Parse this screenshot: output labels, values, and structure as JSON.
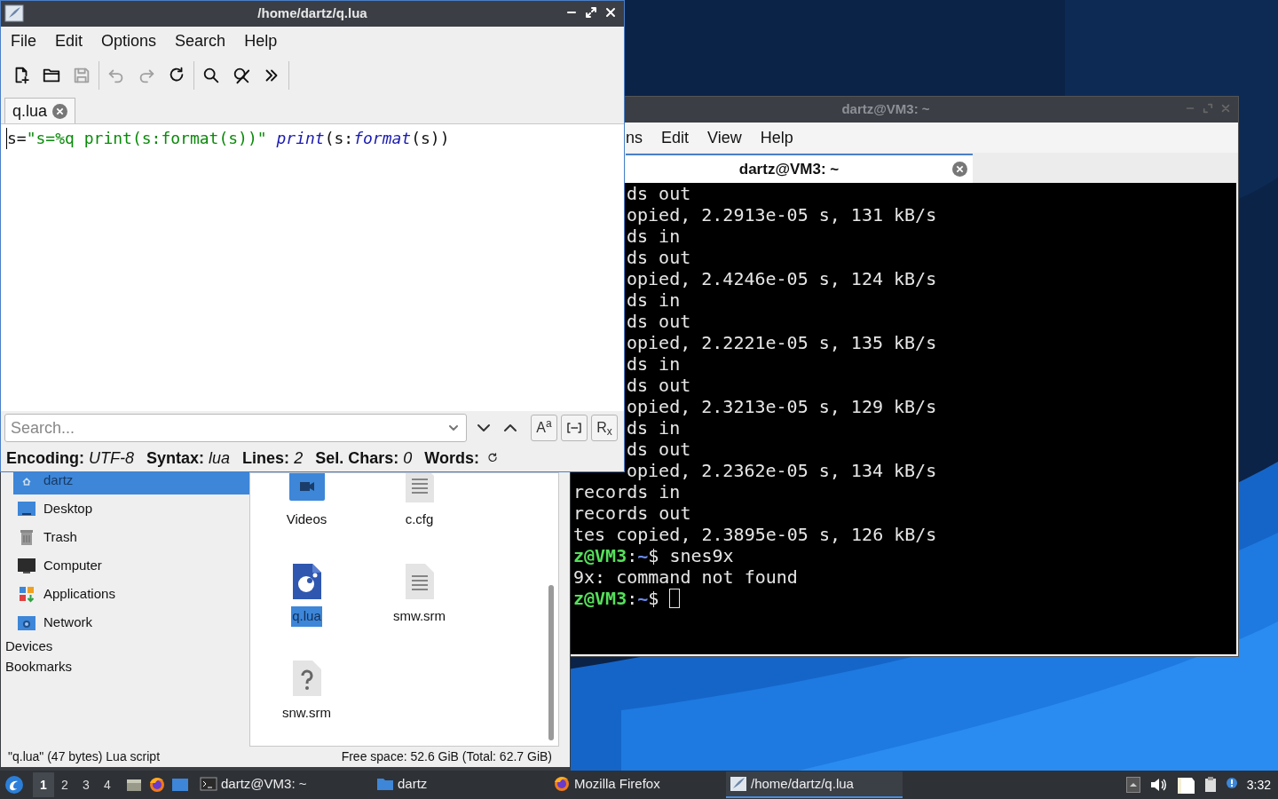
{
  "editor": {
    "title": "/home/dartz/q.lua",
    "menu": [
      "File",
      "Edit",
      "Options",
      "Search",
      "Help"
    ],
    "toolbar": [
      [
        {
          "kind": "new",
          "disabled": false
        },
        {
          "kind": "open",
          "disabled": false
        },
        {
          "kind": "save",
          "disabled": true
        }
      ],
      [
        {
          "kind": "undo",
          "disabled": true
        },
        {
          "kind": "redo",
          "disabled": true
        },
        {
          "kind": "reload",
          "disabled": false
        }
      ],
      [
        {
          "kind": "find",
          "disabled": false
        },
        {
          "kind": "replace",
          "disabled": false
        },
        {
          "kind": "more",
          "disabled": false
        }
      ]
    ],
    "tabs": [
      {
        "label": "q.lua",
        "selected": true
      }
    ],
    "code": [
      {
        "kind": "plain",
        "text": "s="
      },
      {
        "kind": "string",
        "text": "\"s=%q print(s:format(s))\" "
      },
      {
        "kind": "builtin",
        "text": "print"
      },
      {
        "kind": "plain",
        "text": "(s:"
      },
      {
        "kind": "builtin",
        "text": "format"
      },
      {
        "kind": "plain",
        "text": "(s))"
      }
    ],
    "search": {
      "placeholder": "Search..."
    },
    "toggles": [
      {
        "kind": "text",
        "label": "A$^{a}$"
      },
      {
        "kind": "word"
      },
      {
        "kind": "text",
        "label": "R$_{x}$"
      }
    ],
    "status": [
      {
        "label": "Encoding:",
        "value": "UTF-8"
      },
      {
        "label": "Syntax:",
        "value": "lua"
      },
      {
        "label": "Lines:",
        "value": "2"
      },
      {
        "label": "Sel. Chars:",
        "value": "0"
      },
      {
        "label": "Words:"
      }
    ]
  },
  "file_manager": {
    "places": [
      {
        "label": "dartz",
        "kind": "home",
        "selected": true
      },
      {
        "label": "Desktop",
        "kind": "desktop",
        "selected": false
      },
      {
        "label": "Trash",
        "kind": "trash",
        "selected": false
      },
      {
        "label": "Computer",
        "kind": "computer",
        "selected": false
      },
      {
        "label": "Applications",
        "kind": "apps",
        "selected": false
      },
      {
        "label": "Network",
        "kind": "network",
        "selected": false
      }
    ],
    "sections": [
      "Devices",
      "Bookmarks"
    ],
    "files": [
      {
        "name": "Videos",
        "kind": "video-folder",
        "selected": false
      },
      {
        "name": "c.cfg",
        "kind": "text",
        "selected": false
      },
      {
        "name": "q.lua",
        "kind": "lua",
        "selected": true
      },
      {
        "name": "smw.srm",
        "kind": "text",
        "selected": false
      },
      {
        "name": "snw.srm",
        "kind": "unknown",
        "selected": false
      }
    ],
    "status_left": "\"q.lua\" (47 bytes) Lua script",
    "status_right": "Free space: 52.6 GiB (Total: 62.7 GiB)"
  },
  "terminal": {
    "title": "dartz@VM3: ~",
    "menu": [
      "ns",
      "Edit",
      "View",
      "Help"
    ],
    "tabs": [
      {
        "label": "dartz@VM3: ~",
        "selected": true
      }
    ],
    "lines": [
      {
        "kind": "output",
        "text": "ds out"
      },
      {
        "kind": "output",
        "text": "opied, 2.2913e-05 s, 131 kB/s"
      },
      {
        "kind": "output",
        "text": "ds in"
      },
      {
        "kind": "output",
        "text": "ds out"
      },
      {
        "kind": "output",
        "text": "opied, 2.4246e-05 s, 124 kB/s"
      },
      {
        "kind": "output",
        "text": "ds in"
      },
      {
        "kind": "output",
        "text": "ds out"
      },
      {
        "kind": "output",
        "text": "opied, 2.2221e-05 s, 135 kB/s"
      },
      {
        "kind": "output",
        "text": "ds in"
      },
      {
        "kind": "output",
        "text": "ds out"
      },
      {
        "kind": "output",
        "text": "opied, 2.3213e-05 s, 129 kB/s"
      },
      {
        "kind": "output",
        "text": "ds in"
      },
      {
        "kind": "output",
        "text": "ds out"
      },
      {
        "kind": "output",
        "text": "opied, 2.2362e-05 s, 134 kB/s"
      },
      {
        "kind": "output",
        "text": "records in"
      },
      {
        "kind": "output",
        "text": "records out"
      },
      {
        "kind": "output",
        "text": "tes copied, 2.3895e-05 s, 126 kB/s"
      },
      {
        "kind": "prompt",
        "user": "z@VM3",
        "sep": ":",
        "path": "~",
        "symbol": "$",
        "command": "snes9x"
      },
      {
        "kind": "output",
        "text": "9x: command not found"
      },
      {
        "kind": "prompt",
        "user": "z@VM3",
        "sep": ":",
        "path": "~",
        "symbol": "$",
        "cursor": true
      }
    ]
  },
  "taskbar": {
    "workspaces": [
      {
        "label": "1",
        "selected": true
      },
      {
        "label": "2",
        "selected": false
      },
      {
        "label": "3",
        "selected": false
      },
      {
        "label": "4",
        "selected": false
      }
    ],
    "launchers": [
      {
        "kind": "files"
      },
      {
        "kind": "browser"
      },
      {
        "kind": "desktop"
      }
    ],
    "tasks": [
      {
        "label": "dartz@VM3: ~",
        "kind": "terminal",
        "selected": false
      },
      {
        "label": "dartz",
        "kind": "folder",
        "selected": false
      },
      {
        "label": "Mozilla Firefox",
        "kind": "browser",
        "selected": false
      },
      {
        "label": "/home/dartz/q.lua",
        "kind": "editor",
        "selected": true
      }
    ],
    "clock": "3:32"
  }
}
